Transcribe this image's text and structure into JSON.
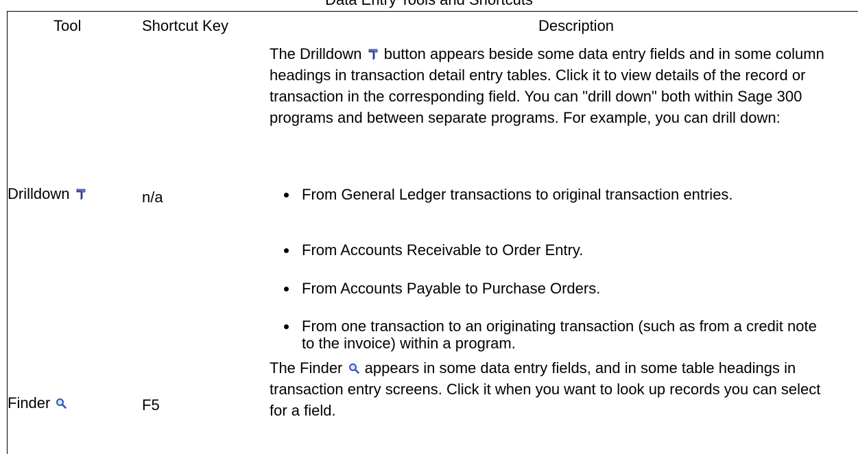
{
  "caption": "Data Entry Tools and Shortcuts",
  "headers": {
    "tool": "Tool",
    "shortcut": "Shortcut Key",
    "description": "Description"
  },
  "rows": [
    {
      "tool": "Drilldown",
      "tool_icon": "drilldown-icon",
      "shortcut": "n/a",
      "paragraph": {
        "before_icon": "The Drilldown",
        "after_icon": "button appears beside some data entry fields and in some column headings in transaction detail entry tables. Click it to view details of the record or transaction in the corresponding field. You can \"drill down\" both within Sage 300 programs and between separate programs. For example, you can drill down:"
      },
      "bullets": [
        "From General Ledger transactions to original transaction entries.",
        "From Accounts Receivable to Order Entry.",
        "From Accounts Payable to Purchase Orders.",
        "From one transaction to an originating transaction (such as from a credit note to the invoice) within a program."
      ]
    },
    {
      "tool": "Finder",
      "tool_icon": "magnifier-icon",
      "shortcut": "F5",
      "paragraph": {
        "before_icon": "The Finder",
        "after_icon": "appears in some data entry fields, and in some table headings in transaction entry screens. Click it when you want to look up records you can select for a field."
      }
    }
  ],
  "colors": {
    "drilldown_icon": "#3a4fb0",
    "finder_icon": "#2a55b8"
  }
}
